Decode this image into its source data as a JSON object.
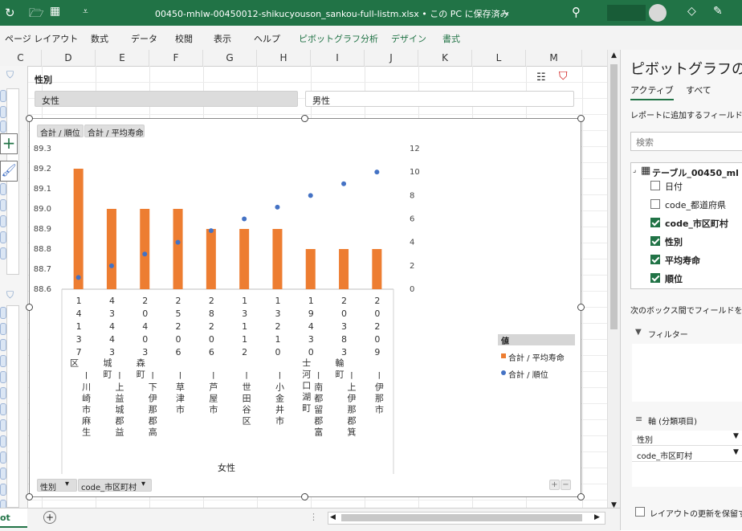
{
  "titlebar": {
    "filename": "00450-mhlw-00450012-shikucyouson_sankou-full-listm.xlsx",
    "save_status": "• この PC に保存済み"
  },
  "ribbon": {
    "tabs": [
      "ページ レイアウト",
      "数式",
      "データ",
      "校閲",
      "表示",
      "ヘルプ",
      "ピボットグラフ分析",
      "デザイン",
      "書式"
    ]
  },
  "sheet": {
    "columns": [
      "C",
      "D",
      "E",
      "F",
      "G",
      "H",
      "I",
      "J",
      "K",
      "L",
      "M"
    ],
    "tab_label": "ot"
  },
  "slicer": {
    "title": "性別",
    "buttons": [
      "女性",
      "男性"
    ]
  },
  "chart": {
    "field_buttons_top": [
      "合計 / 順位",
      "合計 / 平均寿命"
    ],
    "field_buttons_bottom": [
      "性別",
      "code_市区町村"
    ],
    "legend_title": "値",
    "xaxis_group": "女性"
  },
  "chart_data": {
    "type": "bar",
    "categories": [
      {
        "code": "14137",
        "name": "区 ー川崎市麻生"
      },
      {
        "code": "43443",
        "name": "城町 ー上益城郡益"
      },
      {
        "code": "20403",
        "name": "森町 ー下伊那郡高"
      },
      {
        "code": "25206",
        "name": "ー草津市"
      },
      {
        "code": "28206",
        "name": "ー芦屋市"
      },
      {
        "code": "13112",
        "name": "ー世田谷区"
      },
      {
        "code": "13210",
        "name": "ー小金井市"
      },
      {
        "code": "19430",
        "name": "士河口湖町 ー南都留郡富"
      },
      {
        "code": "20383",
        "name": "輪町 ー上伊那郡箕"
      },
      {
        "code": "20209",
        "name": "ー伊那市"
      }
    ],
    "series": [
      {
        "name": "合計 / 平均寿命",
        "type": "bar",
        "axis": "left",
        "color": "#ED7D31",
        "values": [
          89.2,
          89.0,
          89.0,
          89.0,
          88.9,
          88.9,
          88.9,
          88.8,
          88.8,
          88.8
        ]
      },
      {
        "name": "合計 / 順位",
        "type": "scatter",
        "axis": "right",
        "color": "#4472C4",
        "values": [
          1,
          2,
          3,
          4,
          5,
          6,
          7,
          8,
          9,
          10
        ]
      }
    ],
    "y_left": {
      "min": 88.6,
      "max": 89.3,
      "step": 0.1
    },
    "y_right": {
      "min": 0,
      "max": 12,
      "step": 2
    },
    "legend_position": "right"
  },
  "pane": {
    "title": "ピボットグラフのフィ",
    "tabs": [
      "アクティブ",
      "すべて"
    ],
    "instruction": "レポートに追加するフィールドを選",
    "search_placeholder": "検索",
    "table_name": "テーブル_00450_ml",
    "fields": [
      {
        "label": "日付",
        "checked": false
      },
      {
        "label": "code_都道府県",
        "checked": false
      },
      {
        "label": "code_市区町村",
        "checked": true
      },
      {
        "label": "性別",
        "checked": true
      },
      {
        "label": "平均寿命",
        "checked": true
      },
      {
        "label": "順位",
        "checked": true
      }
    ],
    "drag_instruction": "次のボックス間でフィールドをドラ",
    "filter_label": "フィルター",
    "axis_label": "軸 (分類項目)",
    "axis_items": [
      "性別",
      "code_市区町村"
    ],
    "defer_label": "レイアウトの更新を保留す"
  }
}
